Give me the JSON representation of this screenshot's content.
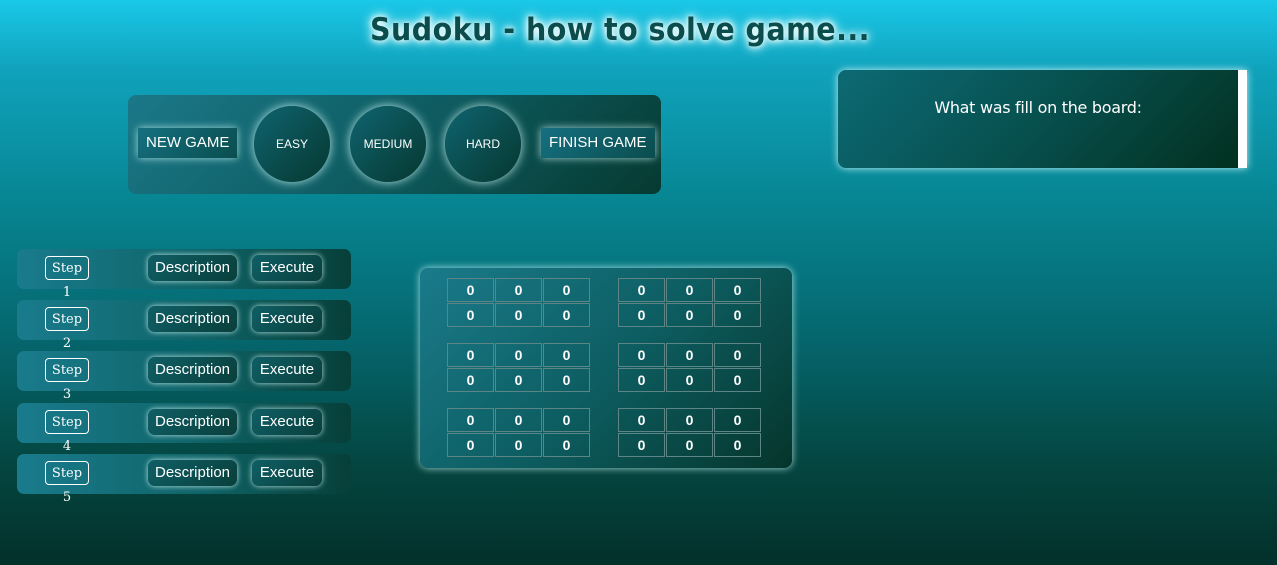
{
  "title": "Sudoku - how to solve game...",
  "controls": {
    "new_game": "NEW GAME",
    "easy": "EASY",
    "medium": "MEDIUM",
    "hard": "HARD",
    "finish_game": "FINISH GAME"
  },
  "info": {
    "text": "What was fill on the board:"
  },
  "steps": [
    {
      "label": "Step 1",
      "description": "Description",
      "execute": "Execute"
    },
    {
      "label": "Step 2",
      "description": "Description",
      "execute": "Execute"
    },
    {
      "label": "Step 3",
      "description": "Description",
      "execute": "Execute"
    },
    {
      "label": "Step 4",
      "description": "Description",
      "execute": "Execute"
    },
    {
      "label": "Step 5",
      "description": "Description",
      "execute": "Execute"
    }
  ],
  "board": {
    "rows": [
      [
        "0",
        "0",
        "0",
        "0",
        "0",
        "0"
      ],
      [
        "0",
        "0",
        "0",
        "0",
        "0",
        "0"
      ],
      [
        "0",
        "0",
        "0",
        "0",
        "0",
        "0"
      ],
      [
        "0",
        "0",
        "0",
        "0",
        "0",
        "0"
      ],
      [
        "0",
        "0",
        "0",
        "0",
        "0",
        "0"
      ],
      [
        "0",
        "0",
        "0",
        "0",
        "0",
        "0"
      ]
    ]
  }
}
